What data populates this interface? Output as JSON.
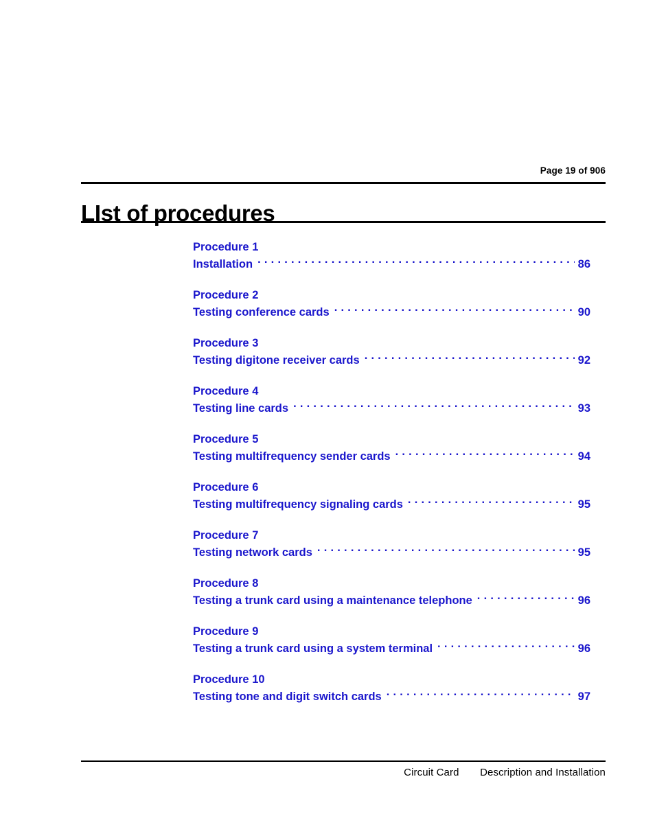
{
  "header": {
    "page_number_label": "Page 19 of 906",
    "title": "LIst of procedures"
  },
  "colors": {
    "link_blue": "#1a16cc",
    "text_black": "#000000",
    "page_background": "#ffffff"
  },
  "toc": {
    "entries": [
      {
        "procedure": "Procedure 1",
        "title": "Installation",
        "page": "86"
      },
      {
        "procedure": "Procedure 2",
        "title": "Testing conference cards",
        "page": "90"
      },
      {
        "procedure": "Procedure 3",
        "title": "Testing digitone receiver cards",
        "page": "92"
      },
      {
        "procedure": "Procedure 4",
        "title": "Testing line cards",
        "page": "93"
      },
      {
        "procedure": "Procedure 5",
        "title": "Testing multifrequency sender cards",
        "page": "94"
      },
      {
        "procedure": "Procedure 6",
        "title": "Testing multifrequency signaling cards",
        "page": "95"
      },
      {
        "procedure": "Procedure 7",
        "title": "Testing network cards",
        "page": "95"
      },
      {
        "procedure": "Procedure 8",
        "title": "Testing a trunk card using a maintenance telephone",
        "page": "96"
      },
      {
        "procedure": "Procedure 9",
        "title": "Testing a trunk card using a system terminal",
        "page": "96"
      },
      {
        "procedure": "Procedure 10",
        "title": "Testing tone and digit switch cards",
        "page": "97"
      }
    ]
  },
  "footer": {
    "left_label": "Circuit Card",
    "right_label": "Description and Installation"
  }
}
